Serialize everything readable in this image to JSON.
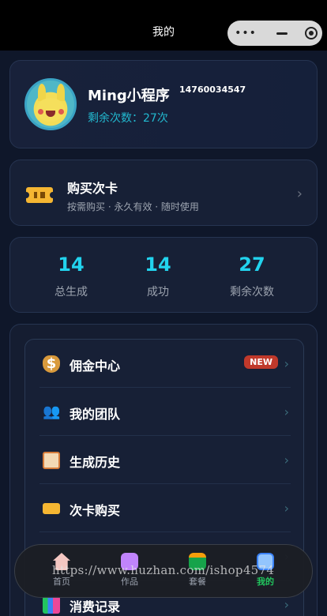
{
  "header": {
    "title": "我的"
  },
  "profile": {
    "name": "Ming小程序",
    "phone": "14760034547",
    "remaining": "剩余次数：27次"
  },
  "buy_card": {
    "title": "购买次卡",
    "subtitle": "按需购买 · 永久有效 · 随时使用"
  },
  "stats": [
    {
      "value": "14",
      "label": "总生成"
    },
    {
      "value": "14",
      "label": "成功"
    },
    {
      "value": "27",
      "label": "剩余次数"
    }
  ],
  "menu": [
    {
      "label": "佣金中心",
      "icon": "money-bag-icon",
      "badge": "NEW"
    },
    {
      "label": "我的团队",
      "icon": "team-icon"
    },
    {
      "label": "生成历史",
      "icon": "clipboard-icon"
    },
    {
      "label": "次卡购买",
      "icon": "ticket-icon"
    },
    {
      "label": "",
      "icon": ""
    },
    {
      "label": "消费记录",
      "icon": "bar-chart-icon"
    }
  ],
  "tabbar": [
    {
      "label": "首页",
      "icon": "home-icon"
    },
    {
      "label": "作品",
      "icon": "works-icon"
    },
    {
      "label": "套餐",
      "icon": "package-icon"
    },
    {
      "label": "我的",
      "icon": "mine-icon",
      "active": true
    }
  ],
  "watermark": "https://www.huzhan.com/ishop4574",
  "colors": {
    "accent": "#22d3ee",
    "active_tab": "#22c55e",
    "badge": "#c0392b",
    "background": "#0f172a"
  }
}
